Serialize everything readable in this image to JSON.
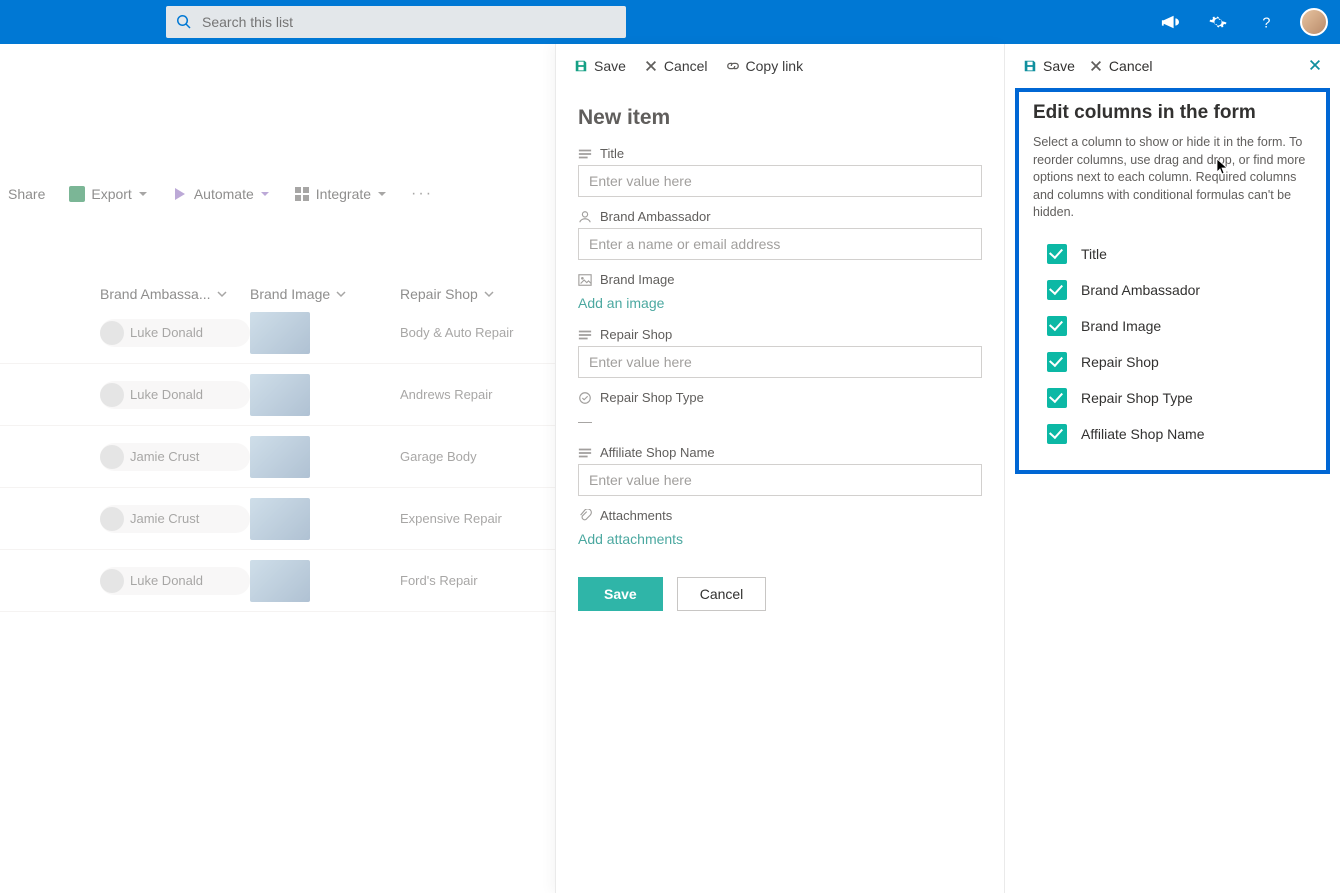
{
  "topbar": {
    "search_placeholder": "Search this list"
  },
  "cmd": {
    "share": "Share",
    "export": "Export",
    "automate": "Automate",
    "integrate": "Integrate"
  },
  "list": {
    "headers": {
      "ambassador": "Brand Ambassa...",
      "image": "Brand Image",
      "shop": "Repair Shop"
    },
    "rows": [
      {
        "person": "Luke Donald",
        "shop": "Body & Auto Repair"
      },
      {
        "person": "Luke Donald",
        "shop": "Andrews Repair"
      },
      {
        "person": "Jamie Crust",
        "shop": "Garage Body"
      },
      {
        "person": "Jamie Crust",
        "shop": "Expensive Repair"
      },
      {
        "person": "Luke Donald",
        "shop": "Ford's Repair"
      }
    ]
  },
  "newpanel": {
    "actions": {
      "save": "Save",
      "cancel": "Cancel",
      "copy": "Copy link"
    },
    "title": "New item",
    "fields": {
      "title": {
        "label": "Title",
        "ph": "Enter value here"
      },
      "ambassador": {
        "label": "Brand Ambassador",
        "ph": "Enter a name or email address"
      },
      "image": {
        "label": "Brand Image",
        "add": "Add an image"
      },
      "shop": {
        "label": "Repair Shop",
        "ph": "Enter value here"
      },
      "shoptype": {
        "label": "Repair Shop Type",
        "value": "—"
      },
      "affiliate": {
        "label": "Affiliate Shop Name",
        "ph": "Enter value here"
      },
      "attach": {
        "label": "Attachments",
        "add": "Add attachments"
      }
    },
    "buttons": {
      "save": "Save",
      "cancel": "Cancel"
    }
  },
  "editpanel": {
    "actions": {
      "save": "Save",
      "cancel": "Cancel"
    },
    "title": "Edit columns in the form",
    "desc": "Select a column to show or hide it in the form. To reorder columns, use drag and drop, or find more options next to each column. Required columns and columns with conditional formulas can't be hidden.",
    "columns": [
      "Title",
      "Brand Ambassador",
      "Brand Image",
      "Repair Shop",
      "Repair Shop Type",
      "Affiliate Shop Name"
    ]
  }
}
